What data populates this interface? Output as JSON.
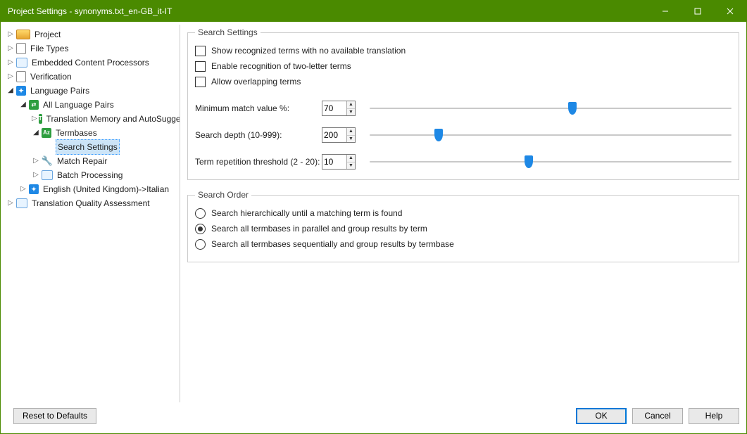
{
  "window": {
    "title": "Project Settings - synonyms.txt_en-GB_it-IT"
  },
  "tree": {
    "project": "Project",
    "filetypes": "File Types",
    "embedded": "Embedded Content Processors",
    "verification": "Verification",
    "langpairs": "Language Pairs",
    "all": "All Language Pairs",
    "tm": "Translation Memory and AutoSuggest",
    "termbases": "Termbases",
    "search": "Search Settings",
    "matchrepair": "Match Repair",
    "batch": "Batch Processing",
    "enit": "English (United Kingdom)->Italian",
    "tqa": "Translation Quality Assessment"
  },
  "search_settings": {
    "legend": "Search Settings",
    "chk_show": "Show recognized terms with no available translation",
    "chk_two": "Enable recognition of two-letter terms",
    "chk_overlap": "Allow overlapping terms",
    "min_label": "Minimum match value %:",
    "min_value": "70",
    "min_pos_pct": 56,
    "depth_label": "Search depth (10-999):",
    "depth_value": "200",
    "depth_pos_pct": 19,
    "rep_label": "Term repetition threshold (2 - 20):",
    "rep_value": "10",
    "rep_pos_pct": 44
  },
  "search_order": {
    "legend": "Search Order",
    "opt1": "Search hierarchically until a matching term is found",
    "opt2": "Search all termbases in parallel and group results by term",
    "opt3": "Search all termbases sequentially and group results by termbase",
    "selected": 2
  },
  "footer": {
    "reset": "Reset to Defaults",
    "ok": "OK",
    "cancel": "Cancel",
    "help": "Help"
  }
}
